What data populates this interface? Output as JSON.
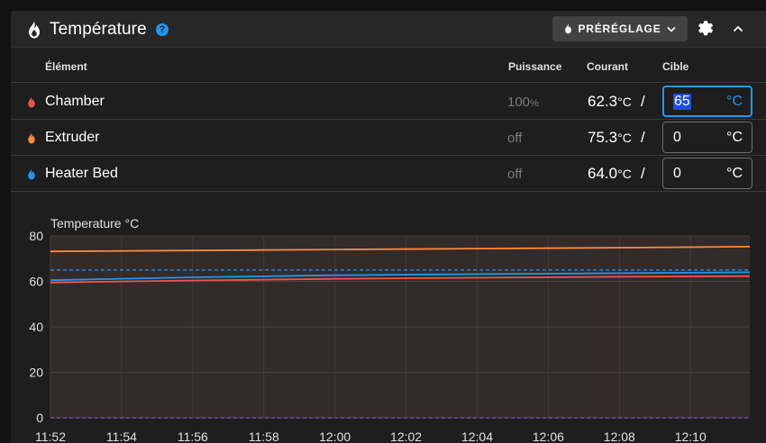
{
  "header": {
    "title": "Température",
    "help_icon": "?",
    "preset_label": "PRÉRÉGLAGE",
    "icons": [
      "flame-icon",
      "help-icon",
      "chevron-down-icon",
      "gear-icon",
      "chevron-up-icon"
    ]
  },
  "table": {
    "columns": {
      "element": "Élément",
      "power": "Puissance",
      "current": "Courant",
      "target": "Cible"
    },
    "rows": [
      {
        "name": "Chamber",
        "color": "#ef5350",
        "power": "100",
        "power_unit": "%",
        "current": "62.3",
        "current_unit": "°C",
        "slash": "/",
        "target": "65",
        "target_unit": "°C",
        "focused": true
      },
      {
        "name": "Extruder",
        "color": "#ff8a3d",
        "power": "off",
        "power_unit": "",
        "current": "75.3",
        "current_unit": "°C",
        "slash": "/",
        "target": "0",
        "target_unit": "°C",
        "focused": false
      },
      {
        "name": "Heater Bed",
        "color": "#2196f3",
        "power": "off",
        "power_unit": "",
        "current": "64.0",
        "current_unit": "°C",
        "slash": "/",
        "target": "0",
        "target_unit": "°C",
        "focused": false
      }
    ]
  },
  "chart_data": {
    "type": "line",
    "title": "Temperature °C",
    "xlabel": "",
    "ylabel": "",
    "x_ticks": [
      "11:52",
      "11:54",
      "11:56",
      "11:58",
      "12:00",
      "12:02",
      "12:04",
      "12:06",
      "12:08",
      "12:10"
    ],
    "y_ticks": [
      "0",
      "20",
      "40",
      "60",
      "80"
    ],
    "ylim": [
      0,
      80
    ],
    "xlim": [
      "11:52",
      "12:11:40"
    ],
    "grid": true,
    "series": [
      {
        "name": "Extruder",
        "color": "#ff8a3d",
        "x": [
          "11:52",
          "11:56",
          "12:00",
          "12:04",
          "12:08",
          "12:11:40"
        ],
        "values": [
          73.2,
          73.6,
          74.0,
          74.4,
          74.8,
          75.3
        ]
      },
      {
        "name": "Heater Bed",
        "color": "#2196f3",
        "x": [
          "11:52",
          "11:56",
          "12:00",
          "12:04",
          "12:08",
          "12:11:40"
        ],
        "values": [
          60.5,
          61.8,
          62.7,
          63.2,
          63.6,
          64.0
        ]
      },
      {
        "name": "Chamber",
        "color": "#ef5350",
        "x": [
          "11:52",
          "11:56",
          "12:00",
          "12:04",
          "12:08",
          "12:11:40"
        ],
        "values": [
          59.5,
          60.4,
          61.1,
          61.6,
          62.0,
          62.3
        ]
      }
    ],
    "target_lines": [
      {
        "name": "Chamber",
        "color": "#2196f3",
        "value": 65
      },
      {
        "name": "Extruder",
        "color": "#7e57c2",
        "value": 0
      }
    ]
  }
}
